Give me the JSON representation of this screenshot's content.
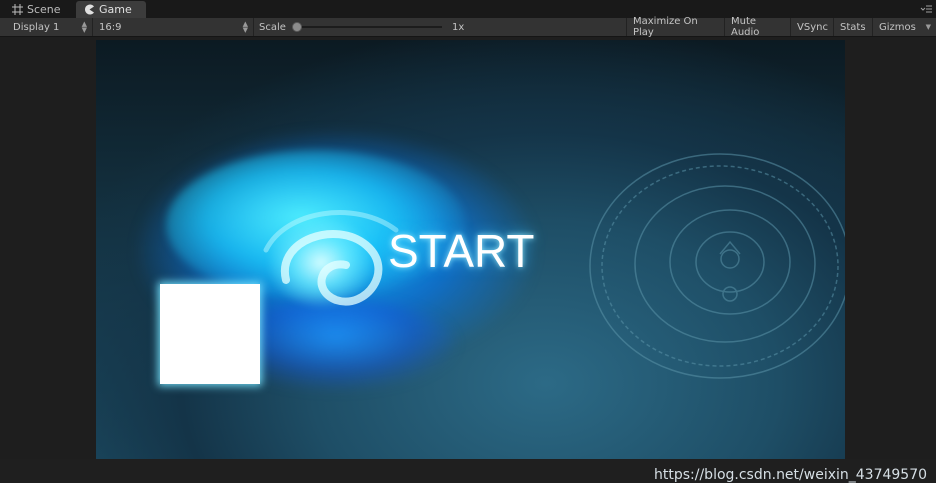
{
  "tabs": [
    {
      "label": "Scene",
      "icon": "scene-grid-icon"
    },
    {
      "label": "Game",
      "icon": "game-pacman-icon"
    }
  ],
  "toolbar": {
    "display": "Display 1",
    "aspect": "16:9",
    "scale_label": "Scale",
    "scale_value": "1x",
    "maximize_on_play": "Maximize On Play",
    "mute_audio": "Mute Audio",
    "vsync": "VSync",
    "stats": "Stats",
    "gizmos": "Gizmos"
  },
  "game": {
    "start_label": "START"
  },
  "watermark": "https://blog.csdn.net/weixin_43749570",
  "colors": {
    "editor_bg": "#1f1f1f",
    "toolbar_bg": "#333333",
    "active_tab_bg": "#3c3c3c",
    "glow_cyan": "#14b4ff",
    "start_text": "#ffffff"
  }
}
